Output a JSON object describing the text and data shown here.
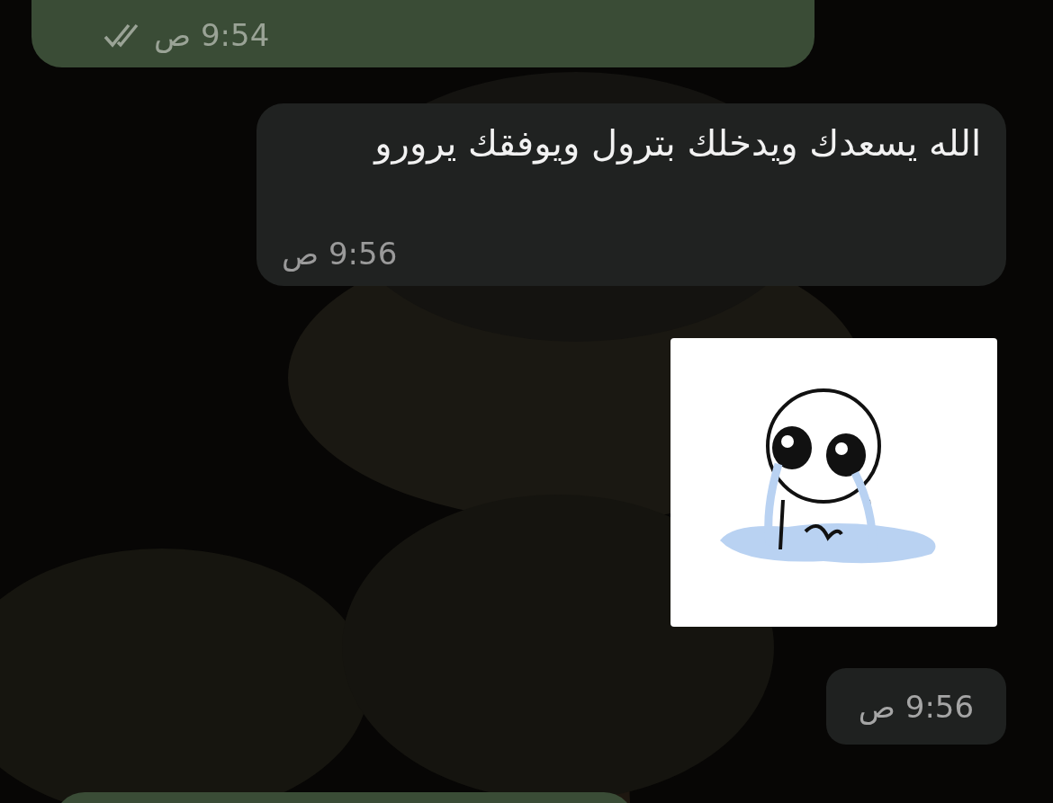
{
  "messages": [
    {
      "kind": "outgoing",
      "time": "9:54 ص",
      "read": true
    },
    {
      "kind": "incoming",
      "text": "الله يسعدك ويدخلك بترول ويوفقك يرورو",
      "time": "9:56 ص"
    },
    {
      "kind": "sticker",
      "time": "9:56 ص"
    },
    {
      "kind": "outgoing"
    }
  ]
}
